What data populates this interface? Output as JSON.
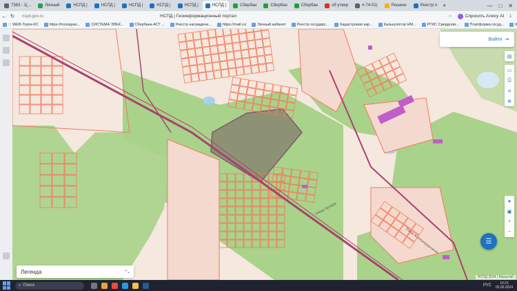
{
  "browser": {
    "tabs": [
      {
        "label": "7383 - 1(...",
        "color": "#5f6368",
        "active": false
      },
      {
        "label": "Личный",
        "color": "#2e9d57",
        "active": false
      },
      {
        "label": "НСПД |",
        "color": "#1e73be",
        "active": false
      },
      {
        "label": "НСПД |",
        "color": "#1e73be",
        "active": false
      },
      {
        "label": "НСПД |",
        "color": "#1e73be",
        "active": false
      },
      {
        "label": "НСПД |",
        "color": "#1e73be",
        "active": false
      },
      {
        "label": "НСПД |",
        "color": "#1e73be",
        "active": false
      },
      {
        "label": "НСПД |",
        "color": "#1e73be",
        "active": true
      },
      {
        "label": "Сбербан",
        "color": "#21a038",
        "active": false
      },
      {
        "label": "Сбербан",
        "color": "#21a038",
        "active": false
      },
      {
        "label": "Сбербан",
        "color": "#21a038",
        "active": false
      },
      {
        "label": "об утвер",
        "color": "#d93025",
        "active": false
      },
      {
        "label": "#-74-01(",
        "color": "#5f6368",
        "active": false
      },
      {
        "label": "Решени",
        "color": "#f4b400",
        "active": false
      },
      {
        "label": "Реестр п",
        "color": "#1e73be",
        "active": false
      }
    ],
    "new_tab": "+",
    "window_controls": [
      "—",
      "□",
      "✕"
    ],
    "url": "nspd.gov.ru",
    "page_title": "НСПД | Геоинформационный портал",
    "alice_label": "Спросить Алису AI",
    "bookmarks": [
      "::: WEB-Торги-КС",
      "https://mosiapas...",
      "СИСТЕМА ЭЛЕК...",
      "Сбербанк-АСТ ...",
      "Реестр насаждени...",
      "https://mail.ru/",
      "Личный кабинет",
      "Реестр государс...",
      "Кадастровая кар...",
      "Калькулятор НМ...",
      "РГИС Свердлов...",
      "Платформа госуд...",
      "Kaspersky Endpo...",
      "Реестр государ..."
    ]
  },
  "map": {
    "login_label": "Войти",
    "legend_label": "Легенда",
    "legend_chevron": "⌃⌄",
    "street_label_1": "Улица Луговая",
    "street_label_2": "Улица Железнодорожная",
    "attribution": "НСПД 2024 | Масштаб",
    "colors": {
      "land": "#f4e8df",
      "forest": "#a9d28a",
      "parcel": "#f47a5a",
      "road": "#a8426e",
      "building": "#c05ec9",
      "water": "#a9cfee",
      "selected": "#8c8c72"
    }
  },
  "taskbar": {
    "search_placeholder": "Поиск",
    "language": "РУС",
    "time": "15:21",
    "date": "05.06.2024"
  }
}
